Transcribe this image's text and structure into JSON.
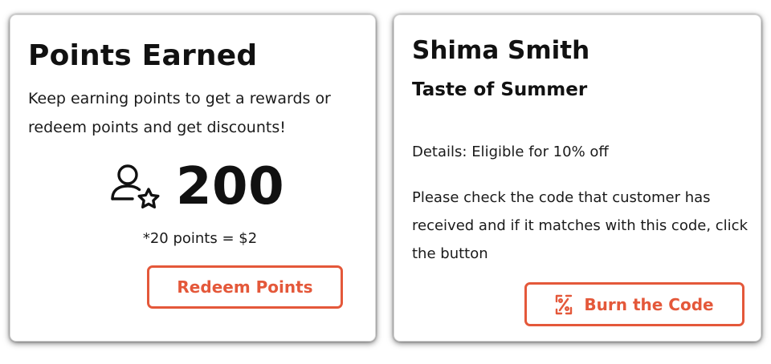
{
  "points_card": {
    "title": "Points Earned",
    "description": "Keep earning points to get a rewards or redeem points and get discounts!",
    "points_value": "200",
    "points_icon": "user-star-icon",
    "conversion_note": "*20 points = $2",
    "redeem_button_label": "Redeem Points"
  },
  "customer_card": {
    "customer_name": "Shima Smith",
    "promotion_title": "Taste of Summer",
    "details": "Details: Eligible for 10% off",
    "instructions": "Please check the code that customer has received and if it matches with this code, click the button",
    "burn_button_label": "Burn the Code",
    "burn_button_icon": "percent-ticket-icon"
  },
  "colors": {
    "accent": "#e4583a",
    "text": "#111111",
    "card_background": "#ffffff"
  }
}
